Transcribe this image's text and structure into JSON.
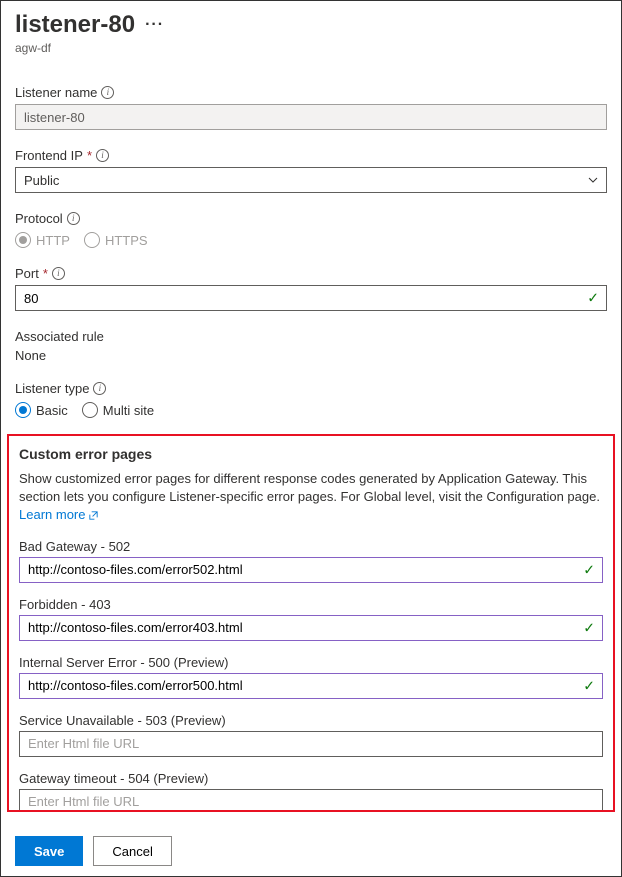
{
  "header": {
    "title": "listener-80",
    "subtitle": "agw-df"
  },
  "fields": {
    "listener_name": {
      "label": "Listener name",
      "value": "listener-80"
    },
    "frontend_ip": {
      "label": "Frontend IP",
      "value": "Public"
    },
    "protocol": {
      "label": "Protocol",
      "options": {
        "http": "HTTP",
        "https": "HTTPS"
      },
      "selected": "http"
    },
    "port": {
      "label": "Port",
      "value": "80"
    },
    "associated_rule": {
      "label": "Associated rule",
      "value": "None"
    },
    "listener_type": {
      "label": "Listener type",
      "options": {
        "basic": "Basic",
        "multi": "Multi site"
      },
      "selected": "basic"
    }
  },
  "custom_errors": {
    "title": "Custom error pages",
    "desc": "Show customized error pages for different response codes generated by Application Gateway. This section lets you configure Listener-specific error pages. For Global level, visit the Configuration page.",
    "learn_more": "Learn more",
    "placeholder": "Enter Html file URL",
    "items": [
      {
        "label": "Bad Gateway - 502",
        "value": "http://contoso-files.com/error502.html",
        "valid": true
      },
      {
        "label": "Forbidden - 403",
        "value": "http://contoso-files.com/error403.html",
        "valid": true
      },
      {
        "label": "Internal Server Error - 500 (Preview)",
        "value": "http://contoso-files.com/error500.html",
        "valid": true
      },
      {
        "label": "Service Unavailable - 503 (Preview)",
        "value": "",
        "valid": false
      },
      {
        "label": "Gateway timeout - 504 (Preview)",
        "value": "",
        "valid": false
      }
    ]
  },
  "footer": {
    "save": "Save",
    "cancel": "Cancel"
  }
}
